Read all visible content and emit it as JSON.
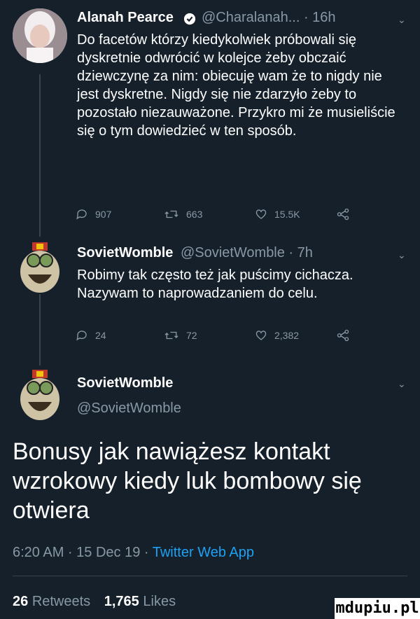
{
  "tweet1": {
    "display_name": "Alanah Pearce",
    "meta": "@Charalanah... · 16h",
    "text": "Do facetów którzy kiedykolwiek próbowali się dyskretnie odwrócić w kolejce żeby obczaić dziewczynę za nim: obiecuję wam że to nigdy nie jest dyskretne. Nigdy się nie zdarzyło żeby to pozostało niezauważone. Przykro mi że musieliście się o tym dowiedzieć w ten sposób.",
    "replies": "907",
    "retweets": "663",
    "likes": "15.5K"
  },
  "tweet2": {
    "display_name": "SovietWomble",
    "meta": "@SovietWomble · 7h",
    "text": "Robimy tak często też jak puścimy cichacza. Nazywam to naprowadzaniem do celu.",
    "replies": "24",
    "retweets": "72",
    "likes": "2,382"
  },
  "main": {
    "display_name": "SovietWomble",
    "handle": "@SovietWomble",
    "text": "Bonusy jak nawiążesz kontakt wzrokowy kiedy luk bombowy się otwiera",
    "timestamp": "6:20 AM · 15 Dec 19 · ",
    "source": "Twitter Web App",
    "retweet_count": "26",
    "retweet_label": "Retweets",
    "like_count": "1,765",
    "like_label": "Likes"
  },
  "watermark": "mdupiu.pl",
  "colors": {
    "background": "#15202b",
    "muted": "#8899a6",
    "link": "#1da1f2",
    "divider": "#38444d"
  }
}
